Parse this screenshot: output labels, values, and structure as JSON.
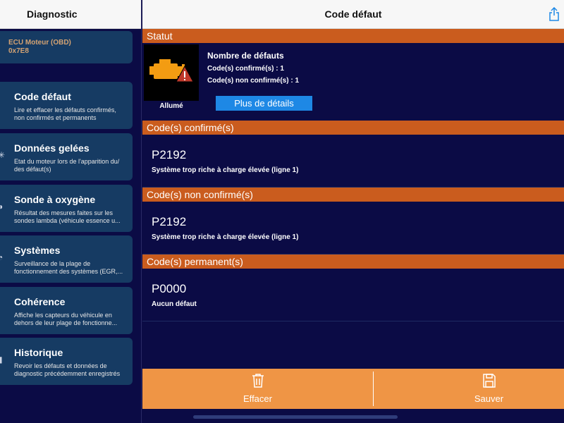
{
  "sidebar": {
    "title": "Diagnostic",
    "ecu": {
      "name": "ECU Moteur (OBD)",
      "address": "0x7E8"
    },
    "items": [
      {
        "title": "Code défaut",
        "desc": "Lire et effacer les défauts confirmés, non confirmés et permanents"
      },
      {
        "title": "Données gelées",
        "desc": "Etat du moteur lors de l'apparition du/ des défaut(s)"
      },
      {
        "title": "Sonde à oxygène",
        "desc": "Résultat des mesures faites sur les sondes lambda (véhicule essence u..."
      },
      {
        "title": "Systèmes",
        "desc": "Surveillance de la plage de fonctionnement des systèmes (EGR,..."
      },
      {
        "title": "Cohérence",
        "desc": "Affiche les capteurs du véhicule en dehors de leur plage de fonctionne..."
      },
      {
        "title": "Historique",
        "desc": "Revoir les défauts et données de diagnostic précédemment enregistrés"
      }
    ]
  },
  "main": {
    "title": "Code défaut",
    "status": {
      "header": "Statut",
      "mil_label": "Allumé",
      "faults_title": "Nombre de défauts",
      "confirmed_line": "Code(s) confirmé(s) : 1",
      "unconfirmed_line": "Code(s) non confirmé(s) : 1",
      "details_button": "Plus de détails"
    },
    "sections": [
      {
        "header": "Code(s) confirmé(s)",
        "code": "P2192",
        "desc": "Système trop riche à charge élevée (ligne 1)"
      },
      {
        "header": "Code(s) non confirmé(s)",
        "code": "P2192",
        "desc": "Système trop riche à charge élevée (ligne 1)"
      },
      {
        "header": "Code(s) permanent(s)",
        "code": "P0000",
        "desc": "Aucun défaut"
      }
    ]
  },
  "toolbar": {
    "clear_label": "Effacer",
    "save_label": "Sauver"
  },
  "icons": {
    "share": "share-icon",
    "engine": "check-engine-icon",
    "trash": "trash-icon",
    "save": "floppy-disk-icon"
  },
  "colors": {
    "background": "#0b0b45",
    "card": "#163b63",
    "section_header": "#ca5c1e",
    "toolbar": "#ef9545",
    "button": "#1e88e5",
    "engine_icon": "#f39c12",
    "warning": "#c0392b"
  }
}
